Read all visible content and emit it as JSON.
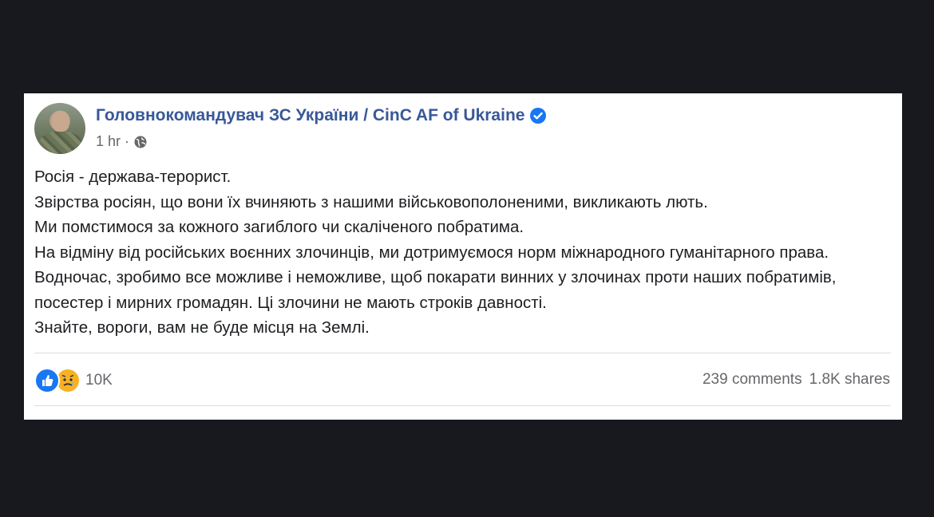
{
  "post": {
    "author": "Головнокомандувач ЗС України / CinC AF of Ukraine",
    "verified_icon": "verified-badge-icon",
    "time": "1 hr",
    "separator": "·",
    "audience_icon": "globe-icon",
    "paragraphs": [
      "Росія - держава-терорист.",
      "Звірства росіян, що вони їх вчиняють з нашими військовополоненими, викликають лють.",
      "Ми помстимося за кожного загиблого чи скаліченого побратима.",
      "На відміну від російських воєнних злочинців, ми дотримуємося норм міжнародного гуманітарного права. Водночас, зробимо все можливе і неможливе, щоб покарати винних у злочинах проти наших побратимів, посестер і мирних громадян. Ці злочини не мають строків давності.",
      "Знайте, вороги, вам не буде місця на Землі."
    ]
  },
  "footer": {
    "reaction_icons": [
      "like-icon",
      "sad-icon"
    ],
    "reaction_count": "10K",
    "comments": "239 comments",
    "shares": "1.8K shares"
  },
  "colors": {
    "author": "#385898",
    "verified": "#1877f2",
    "background": "#18191e",
    "card": "#ffffff"
  }
}
